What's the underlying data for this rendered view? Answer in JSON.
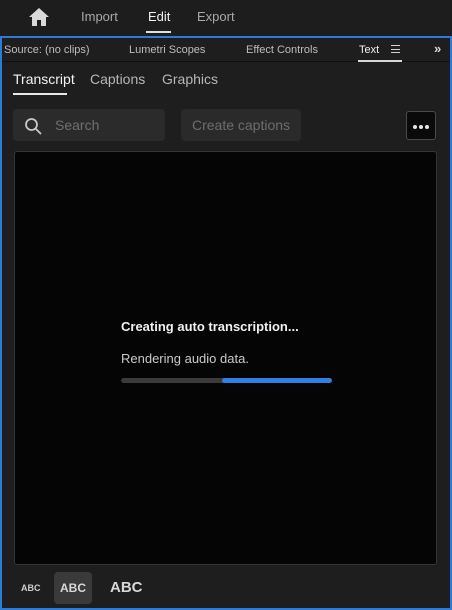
{
  "topbar": {
    "home_icon": "home-icon",
    "nav": [
      {
        "label": "Import"
      },
      {
        "label": "Edit"
      },
      {
        "label": "Export"
      }
    ],
    "active": "Edit"
  },
  "panel": {
    "tabs": [
      {
        "label": "Source: (no clips)"
      },
      {
        "label": "Lumetri Scopes"
      },
      {
        "label": "Effect Controls"
      },
      {
        "label": "Text"
      }
    ],
    "active_tab": "Text",
    "menu_icon": "hamburger-menu-icon",
    "overflow_icon": "double-chevron-right-icon",
    "overflow_glyph": "»"
  },
  "subtabs": {
    "items": [
      {
        "label": "Transcript"
      },
      {
        "label": "Captions"
      },
      {
        "label": "Graphics"
      }
    ],
    "active": "Transcript"
  },
  "toolbar": {
    "search_placeholder": "Search",
    "search_value": "",
    "create_captions_label": "Create captions",
    "more_icon": "more-options-icon"
  },
  "status": {
    "title": "Creating auto transcription...",
    "subtitle": "Rendering audio data.",
    "progress_percent": 52
  },
  "colors": {
    "accent": "#2d7bd8",
    "progress": "#2f80e0"
  },
  "text_size": {
    "small": "ABC",
    "medium": "ABC",
    "large": "ABC",
    "selected": "medium"
  }
}
